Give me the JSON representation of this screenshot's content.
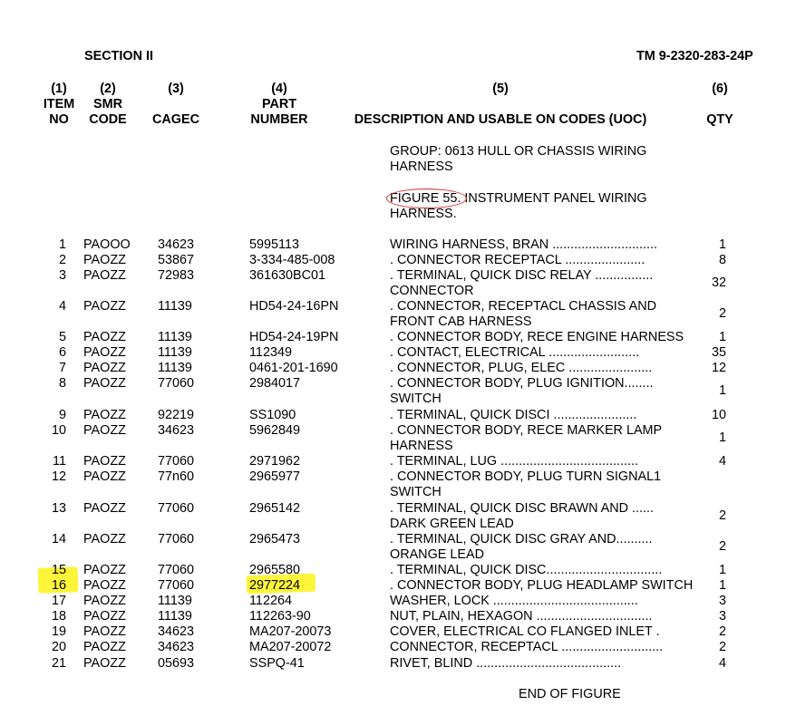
{
  "header": {
    "section": "SECTION II",
    "tm": "TM 9-2320-283-24P"
  },
  "columns": {
    "c1": [
      "(1)",
      "ITEM",
      "NO"
    ],
    "c2": [
      "(2)",
      "SMR",
      "CODE"
    ],
    "c3": [
      "(3)",
      "CAGEC"
    ],
    "c4": [
      "(4)",
      "PART",
      "NUMBER"
    ],
    "c5": [
      "(5)",
      "DESCRIPTION AND USABLE ON CODES (UOC)"
    ],
    "c6": [
      "(6)",
      "QTY"
    ]
  },
  "group": [
    "GROUP: 0613  HULL OR CHASSIS WIRING",
    "HARNESS"
  ],
  "figure": {
    "label": "FIGURE 55.",
    "title_rest": " INSTRUMENT PANEL WIRING",
    "title_line2": "HARNESS."
  },
  "rows": [
    {
      "item": "1",
      "smr": "PAOOO",
      "cage": "34623",
      "part": "5995113",
      "desc": [
        "WIRING HARNESS, BRAN ............................."
      ],
      "qty": "1"
    },
    {
      "item": "2",
      "smr": "PAOZZ",
      "cage": "53867",
      "part": "3-334-485-008",
      "desc": [
        ".  CONNECTOR RECEPTACL ......................"
      ],
      "qty": "8"
    },
    {
      "item": "3",
      "smr": "PAOZZ",
      "cage": "72983",
      "part": "361630BC01",
      "desc": [
        ".  TERMINAL, QUICK DISC RELAY ................",
        "CONNECTOR"
      ],
      "qty": "32"
    },
    {
      "item": "4",
      "smr": "PAOZZ",
      "cage": "11139",
      "part": "HD54-24-16PN",
      "desc": [
        ".  CONNECTOR, RECEPTACL CHASSIS AND",
        "FRONT CAB HARNESS"
      ],
      "qty": "2"
    },
    {
      "item": "5",
      "smr": "PAOZZ",
      "cage": "11139",
      "part": "HD54-24-19PN",
      "desc": [
        ".  CONNECTOR BODY, RECE ENGINE HARNESS"
      ],
      "qty": "1"
    },
    {
      "item": "6",
      "smr": "PAOZZ",
      "cage": "11139",
      "part": "112349",
      "desc": [
        ".  CONTACT, ELECTRICAL ........................."
      ],
      "qty": "35"
    },
    {
      "item": "7",
      "smr": "PAOZZ",
      "cage": "11139",
      "part": "0461-201-1690",
      "desc": [
        ".  CONNECTOR, PLUG, ELEC ......................."
      ],
      "qty": "12"
    },
    {
      "item": "8",
      "smr": "PAOZZ",
      "cage": "77060",
      "part": "2984017",
      "desc": [
        ".  CONNECTOR BODY, PLUG IGNITION........",
        "SWITCH"
      ],
      "qty": "1"
    },
    {
      "item": "9",
      "smr": "PAOZZ",
      "cage": "92219",
      "part": "SS1090",
      "desc": [
        ".  TERMINAL, QUICK DISCI ......................."
      ],
      "qty": "10"
    },
    {
      "item": "10",
      "smr": "PAOZZ",
      "cage": "34623",
      "part": "5962849",
      "desc": [
        ".  CONNECTOR BODY, RECE MARKER LAMP",
        "HARNESS"
      ],
      "qty": "1"
    },
    {
      "item": "11",
      "smr": "PAOZZ",
      "cage": "77060",
      "part": "2971962",
      "desc": [
        ".  TERMINAL, LUG   ......................................"
      ],
      "qty": "4"
    },
    {
      "item": "12",
      "smr": "PAOZZ",
      "cage": "77n60",
      "part": "2965977",
      "desc": [
        ".  CONNECTOR BODY, PLUG TURN SIGNAL1",
        "SWITCH"
      ],
      "qty": ""
    },
    {
      "item": "13",
      "smr": "PAOZZ",
      "cage": "77060",
      "part": "2965142",
      "desc": [
        ".  TERMINAL, QUICK DISC BRAWN AND ......",
        "DARK GREEN LEAD"
      ],
      "qty": "2"
    },
    {
      "item": "14",
      "smr": "PAOZZ",
      "cage": "77060",
      "part": "2965473",
      "desc": [
        ".  TERMINAL, QUICK DISC GRAY AND..........",
        "ORANGE LEAD"
      ],
      "qty": "2"
    },
    {
      "item": "15",
      "smr": "PAOZZ",
      "cage": "77060",
      "part": "2965580",
      "desc": [
        ".  TERMINAL, QUICK DISC................................"
      ],
      "qty": "1"
    },
    {
      "item": "16",
      "smr": "PAOZZ",
      "cage": "77060",
      "part": "2977224",
      "desc": [
        ".  CONNECTOR BODY, PLUG HEADLAMP SWITCH"
      ],
      "qty": "1"
    },
    {
      "item": "17",
      "smr": "PAOZZ",
      "cage": "11139",
      "part": "112264",
      "desc": [
        "WASHER, LOCK  ........................................"
      ],
      "qty": "3"
    },
    {
      "item": "18",
      "smr": "PAOZZ",
      "cage": "11139",
      "part": "112263-90",
      "desc": [
        "NUT, PLAIN, HEXAGON ................................"
      ],
      "qty": "3"
    },
    {
      "item": "19",
      "smr": "PAOZZ",
      "cage": "34623",
      "part": "MA207-20073",
      "desc": [
        "COVER, ELECTRICAL CO FLANGED INLET ."
      ],
      "qty": "2"
    },
    {
      "item": "20",
      "smr": "PAOZZ",
      "cage": "34623",
      "part": "MA207-20072",
      "desc": [
        "CONNECTOR, RECEPTACL ............................"
      ],
      "qty": "2"
    },
    {
      "item": "21",
      "smr": "PAOZZ",
      "cage": "05693",
      "part": "SSPQ-41",
      "desc": [
        "RIVET, BLIND     ........................................"
      ],
      "qty": "4"
    }
  ],
  "footer": "END OF FIGURE",
  "colors": {
    "highlight": "#fdf53a",
    "circle": "#d82626"
  }
}
